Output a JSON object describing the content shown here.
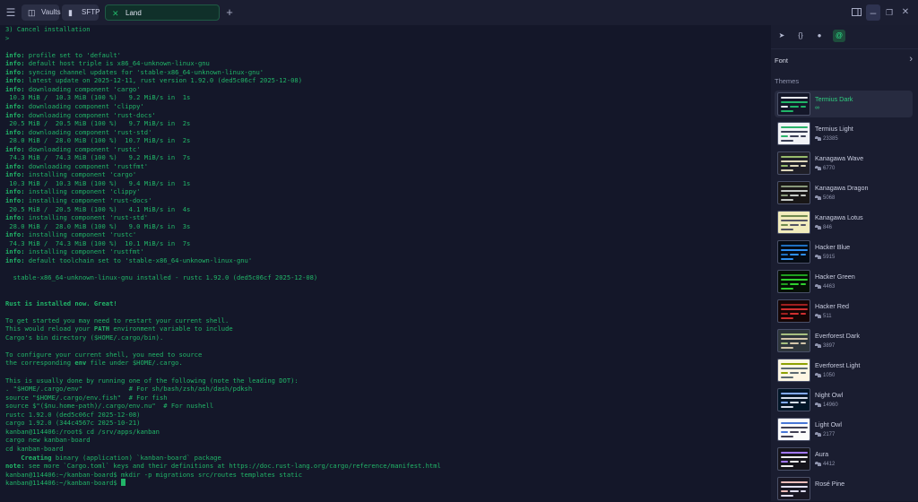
{
  "colors": {
    "terminal_bg": "#141729",
    "terminal_text": "#21b568",
    "accent": "#2ecf7f",
    "panel_bg": "#1a1d30",
    "titlebar_bg": "#1b1e31"
  },
  "titlebar": {
    "menu_icon": "hamburger-icon",
    "tabs": [
      {
        "label": "Vaults",
        "icon": "vaults-icon"
      },
      {
        "label": "SFTP",
        "icon": "folder-icon"
      },
      {
        "label": "Land",
        "icon": "close-icon",
        "active": true
      }
    ],
    "new_tab_icon": "plus-icon",
    "window_icons": [
      "sidebar-icon",
      "minimize-icon",
      "restore-icon",
      "close-icon"
    ]
  },
  "terminal": {
    "lines": [
      [
        {
          "t": "3) Cancel installation"
        }
      ],
      [
        {
          "t": ">"
        }
      ],
      [
        {
          "t": ""
        }
      ],
      [
        {
          "t": "info:",
          "b": true
        },
        {
          "t": " profile set to 'default'"
        }
      ],
      [
        {
          "t": "info:",
          "b": true
        },
        {
          "t": " default host triple is x86_64-unknown-linux-gnu"
        }
      ],
      [
        {
          "t": "info:",
          "b": true
        },
        {
          "t": " syncing channel updates for 'stable-x86_64-unknown-linux-gnu'"
        }
      ],
      [
        {
          "t": "info:",
          "b": true
        },
        {
          "t": " latest update on 2025-12-11, rust version 1.92.0 (ded5c06cf 2025-12-08)"
        }
      ],
      [
        {
          "t": "info:",
          "b": true
        },
        {
          "t": " downloading component 'cargo'"
        }
      ],
      [
        {
          "t": " 10.3 MiB /  10.3 MiB (100 %)   9.2 MiB/s in  1s"
        }
      ],
      [
        {
          "t": "info:",
          "b": true
        },
        {
          "t": " downloading component 'clippy'"
        }
      ],
      [
        {
          "t": "info:",
          "b": true
        },
        {
          "t": " downloading component 'rust-docs'"
        }
      ],
      [
        {
          "t": " 20.5 MiB /  20.5 MiB (100 %)   9.7 MiB/s in  2s"
        }
      ],
      [
        {
          "t": "info:",
          "b": true
        },
        {
          "t": " downloading component 'rust-std'"
        }
      ],
      [
        {
          "t": " 28.0 MiB /  28.0 MiB (100 %)  10.7 MiB/s in  2s"
        }
      ],
      [
        {
          "t": "info:",
          "b": true
        },
        {
          "t": " downloading component 'rustc'"
        }
      ],
      [
        {
          "t": " 74.3 MiB /  74.3 MiB (100 %)   9.2 MiB/s in  7s"
        }
      ],
      [
        {
          "t": "info:",
          "b": true
        },
        {
          "t": " downloading component 'rustfmt'"
        }
      ],
      [
        {
          "t": "info:",
          "b": true
        },
        {
          "t": " installing component 'cargo'"
        }
      ],
      [
        {
          "t": " 10.3 MiB /  10.3 MiB (100 %)   9.4 MiB/s in  1s"
        }
      ],
      [
        {
          "t": "info:",
          "b": true
        },
        {
          "t": " installing component 'clippy'"
        }
      ],
      [
        {
          "t": "info:",
          "b": true
        },
        {
          "t": " installing component 'rust-docs'"
        }
      ],
      [
        {
          "t": " 20.5 MiB /  20.5 MiB (100 %)   4.1 MiB/s in  4s"
        }
      ],
      [
        {
          "t": "info:",
          "b": true
        },
        {
          "t": " installing component 'rust-std'"
        }
      ],
      [
        {
          "t": " 28.0 MiB /  28.0 MiB (100 %)   9.0 MiB/s in  3s"
        }
      ],
      [
        {
          "t": "info:",
          "b": true
        },
        {
          "t": " installing component 'rustc'"
        }
      ],
      [
        {
          "t": " 74.3 MiB /  74.3 MiB (100 %)  10.1 MiB/s in  7s"
        }
      ],
      [
        {
          "t": "info:",
          "b": true
        },
        {
          "t": " installing component 'rustfmt'"
        }
      ],
      [
        {
          "t": "info:",
          "b": true
        },
        {
          "t": " default toolchain set to 'stable-x86_64-unknown-linux-gnu'"
        }
      ],
      [
        {
          "t": ""
        }
      ],
      [
        {
          "t": "  stable-x86_64-unknown-linux-gnu installed - rustc 1.92.0 (ded5c06cf 2025-12-08)"
        }
      ],
      [
        {
          "t": ""
        }
      ],
      [
        {
          "t": ""
        }
      ],
      [
        {
          "t": "Rust is installed now. Great!",
          "b": true
        }
      ],
      [
        {
          "t": ""
        }
      ],
      [
        {
          "t": "To get started you may need to restart your current shell."
        }
      ],
      [
        {
          "t": "This would reload your "
        },
        {
          "t": "PATH",
          "b": true
        },
        {
          "t": " environment variable to include"
        }
      ],
      [
        {
          "t": "Cargo's bin directory ($HOME/.cargo/bin)."
        }
      ],
      [
        {
          "t": ""
        }
      ],
      [
        {
          "t": "To configure your current shell, you need to source"
        }
      ],
      [
        {
          "t": "the corresponding "
        },
        {
          "t": "env",
          "b": true
        },
        {
          "t": " file under $HOME/.cargo."
        }
      ],
      [
        {
          "t": ""
        }
      ],
      [
        {
          "t": "This is usually done by running one of the following (note the leading DOT):"
        }
      ],
      [
        {
          "t": ". \"$HOME/.cargo/env\"            # For sh/bash/zsh/ash/dash/pdksh"
        }
      ],
      [
        {
          "t": "source \"$HOME/.cargo/env.fish\"  # For fish"
        }
      ],
      [
        {
          "t": "source $\"($nu.home-path)/.cargo/env.nu\"  # For nushell"
        }
      ],
      [
        {
          "t": "rustc 1.92.0 (ded5c06cf 2025-12-08)"
        }
      ],
      [
        {
          "t": "cargo 1.92.0 (344c4567c 2025-10-21)"
        }
      ],
      [
        {
          "t": "kanban@114406:/root$ cd /srv/apps/kanban"
        }
      ],
      [
        {
          "t": "cargo new kanban-board"
        }
      ],
      [
        {
          "t": "cd kanban-board"
        }
      ],
      [
        {
          "t": "    Creating",
          "b": true
        },
        {
          "t": " binary (application) `kanban-board` package"
        }
      ],
      [
        {
          "t": "note:",
          "b": true
        },
        {
          "t": " see more `Cargo.toml` keys and their definitions at https://doc.rust-lang.org/cargo/reference/manifest.html"
        }
      ],
      [
        {
          "t": "kanban@114406:~/kanban-board$ mkdir -p migrations src/routes templates static"
        }
      ],
      [
        {
          "t": "kanban@114406:~/kanban-board$ "
        }
      ]
    ]
  },
  "panel": {
    "tabs": [
      "pin-icon",
      "braces-icon",
      "circle-icon",
      "at-icon"
    ],
    "font_label": "Font",
    "themes_label": "Themes",
    "themes": [
      {
        "name": "Termius Dark",
        "meta": "∞",
        "selected": true,
        "bg": "#141729",
        "line": "#21b568",
        "line2": "#e8eaf3"
      },
      {
        "name": "Termius Light",
        "meta": "23385",
        "bg": "#f1f2f6",
        "line": "#3a3f55",
        "line2": "#2bb26a"
      },
      {
        "name": "Kanagawa Wave",
        "meta": "6770",
        "bg": "#1f1f28",
        "line": "#dcd7ba",
        "line2": "#98bb6c"
      },
      {
        "name": "Kanagawa Dragon",
        "meta": "5068",
        "bg": "#181616",
        "line": "#c5c9c5",
        "line2": "#8a9a7b"
      },
      {
        "name": "Kanagawa Lotus",
        "meta": "846",
        "bg": "#f2ecbc",
        "line": "#545464",
        "line2": "#6f894e"
      },
      {
        "name": "Hacker Blue",
        "meta": "5915",
        "bg": "#050b14",
        "line": "#2f8ff0",
        "line2": "#1f6fbf"
      },
      {
        "name": "Hacker Green",
        "meta": "4463",
        "bg": "#050f05",
        "line": "#2fd02f",
        "line2": "#1f9f1f"
      },
      {
        "name": "Hacker Red",
        "meta": "511",
        "bg": "#140505",
        "line": "#d02f2f",
        "line2": "#9f1f1f"
      },
      {
        "name": "Everforest Dark",
        "meta": "3897",
        "bg": "#2d353b",
        "line": "#d3c6aa",
        "line2": "#a7c080"
      },
      {
        "name": "Everforest Light",
        "meta": "1050",
        "bg": "#fdf6e3",
        "line": "#5c6a72",
        "line2": "#8da101"
      },
      {
        "name": "Night Owl",
        "meta": "14960",
        "bg": "#011627",
        "line": "#d6deeb",
        "line2": "#82aaff"
      },
      {
        "name": "Light Owl",
        "meta": "2177",
        "bg": "#fbfbfb",
        "line": "#403f53",
        "line2": "#4876d6"
      },
      {
        "name": "Aura",
        "meta": "4412",
        "bg": "#15141b",
        "line": "#edecee",
        "line2": "#a277ff"
      },
      {
        "name": "Rosé Pine",
        "meta": "",
        "bg": "#191724",
        "line": "#e0def4",
        "line2": "#ebbcba"
      }
    ]
  }
}
